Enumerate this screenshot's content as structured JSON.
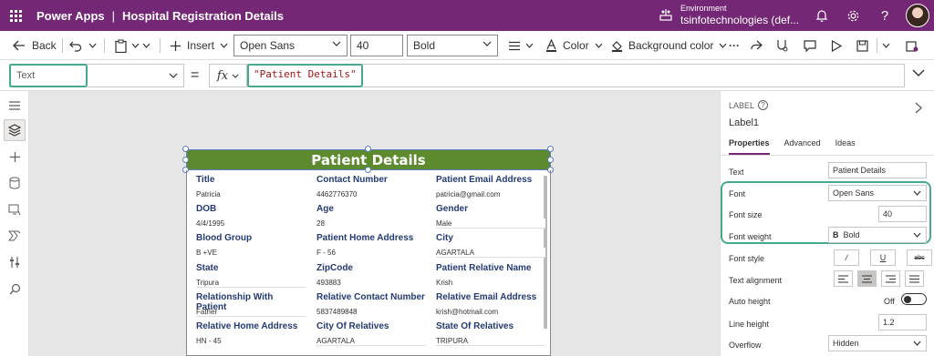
{
  "titlebar": {
    "app_name": "Power Apps",
    "separator": "|",
    "doc_title": "Hospital Registration Details",
    "environment_label": "Environment",
    "environment_name": "tsinfotechnologies (def..."
  },
  "cmdbar": {
    "back_label": "Back",
    "insert_label": "Insert",
    "font_family": "Open Sans",
    "font_size": "40",
    "font_weight": "Bold",
    "color_label": "Color",
    "background_color_label": "Background color",
    "more_label": "···"
  },
  "formula": {
    "property": "Text",
    "equals": "=",
    "fx": "fx",
    "expression": "\"Patient Details\""
  },
  "canvas": {
    "header_text": "Patient Details",
    "fields": [
      {
        "label": "Title",
        "value": "Patricia"
      },
      {
        "label": "Contact Number",
        "value": "4462776370"
      },
      {
        "label": "Patient Email Address",
        "value": "patricia@gmail.com"
      },
      {
        "label": "DOB",
        "value": "4/4/1995"
      },
      {
        "label": "Age",
        "value": "28"
      },
      {
        "label": "Gender",
        "value": "Male"
      },
      {
        "label": "Blood Group",
        "value": "B +VE"
      },
      {
        "label": "Patient Home Address",
        "value": "F - 56"
      },
      {
        "label": "City",
        "value": "AGARTALA"
      },
      {
        "label": "State",
        "value": "Tripura"
      },
      {
        "label": "ZipCode",
        "value": "493883"
      },
      {
        "label": "Patient Relative Name",
        "value": "Krish"
      },
      {
        "label": "Relationship With Patient",
        "value": "Father"
      },
      {
        "label": "Relative Contact Number",
        "value": "5837489848"
      },
      {
        "label": "Relative Email Address",
        "value": "krish@hotmail.com"
      },
      {
        "label": "Relative Home Address",
        "value": "HN - 45"
      },
      {
        "label": "City Of Relatives",
        "value": "AGARTALA"
      },
      {
        "label": "State Of Relatives",
        "value": "TRIPURA"
      }
    ]
  },
  "panel": {
    "kind": "LABEL",
    "help": "?",
    "control_name": "Label1",
    "tabs": [
      "Properties",
      "Advanced",
      "Ideas"
    ],
    "text_label": "Text",
    "text_value": "Patient Details",
    "font_label": "Font",
    "font_value": "Open Sans",
    "font_size_label": "Font size",
    "font_size_value": "40",
    "font_weight_label": "Font weight",
    "font_weight_value": "Bold",
    "font_weight_glyph": "B",
    "font_style_label": "Font style",
    "font_style_options": [
      "/",
      "U",
      "abc"
    ],
    "text_alignment_label": "Text alignment",
    "auto_height_label": "Auto height",
    "auto_height_value": "Off",
    "line_height_label": "Line height",
    "line_height_value": "1.2",
    "overflow_label": "Overflow",
    "overflow_value": "Hidden"
  },
  "colors": {
    "titlebar": "#742774",
    "header_fill": "#5c8a2d",
    "highlight": "#44a98f",
    "field_label": "#243a73"
  }
}
